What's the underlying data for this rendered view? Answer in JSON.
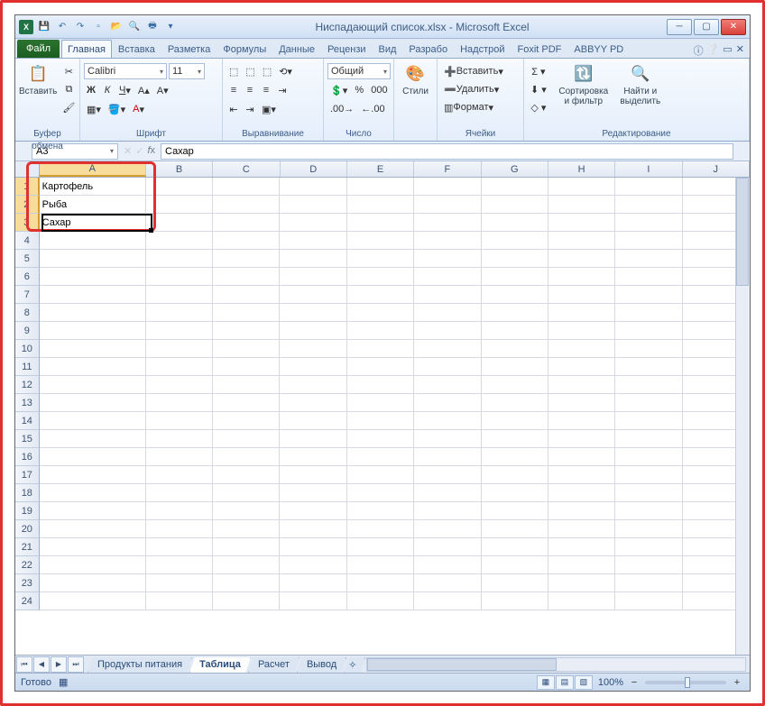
{
  "title": "Ниспадающий список.xlsx - Microsoft Excel",
  "qat": [
    "save-icon",
    "undo-icon",
    "redo-icon",
    "new-icon",
    "open-icon",
    "print-preview-icon",
    "quick-print-icon",
    "spelling-icon"
  ],
  "tabs": {
    "file": "Файл",
    "items": [
      "Главная",
      "Вставка",
      "Разметка",
      "Формулы",
      "Данные",
      "Рецензи",
      "Вид",
      "Разрабо",
      "Надстрой",
      "Foxit PDF",
      "ABBYY PD"
    ],
    "active": 0
  },
  "ribbon": {
    "clipboard": {
      "title": "Буфер обмена",
      "paste": "Вставить"
    },
    "font": {
      "title": "Шрифт",
      "name": "Calibri",
      "size": "11"
    },
    "align": {
      "title": "Выравнивание"
    },
    "number": {
      "title": "Число",
      "format": "Общий"
    },
    "styles": {
      "title": "",
      "btn": "Стили"
    },
    "cells": {
      "title": "Ячейки",
      "insert": "Вставить",
      "delete": "Удалить",
      "format": "Формат"
    },
    "editing": {
      "title": "Редактирование",
      "sort": "Сортировка\nи фильтр",
      "find": "Найти и\nвыделить"
    }
  },
  "formula_bar": {
    "name": "A3",
    "value": "Сахар"
  },
  "columns": [
    "A",
    "B",
    "C",
    "D",
    "E",
    "F",
    "G",
    "H",
    "I",
    "J"
  ],
  "rows": 24,
  "cells": {
    "A1": "Картофель",
    "A2": "Рыба",
    "A3": "Сахар"
  },
  "active_cell": "A3",
  "highlight_range": "A1:A3",
  "sheet_tabs": {
    "items": [
      "Продукты питания",
      "Таблица",
      "Расчет",
      "Вывод"
    ],
    "active": 1
  },
  "status": {
    "ready": "Готово",
    "zoom": "100%"
  }
}
